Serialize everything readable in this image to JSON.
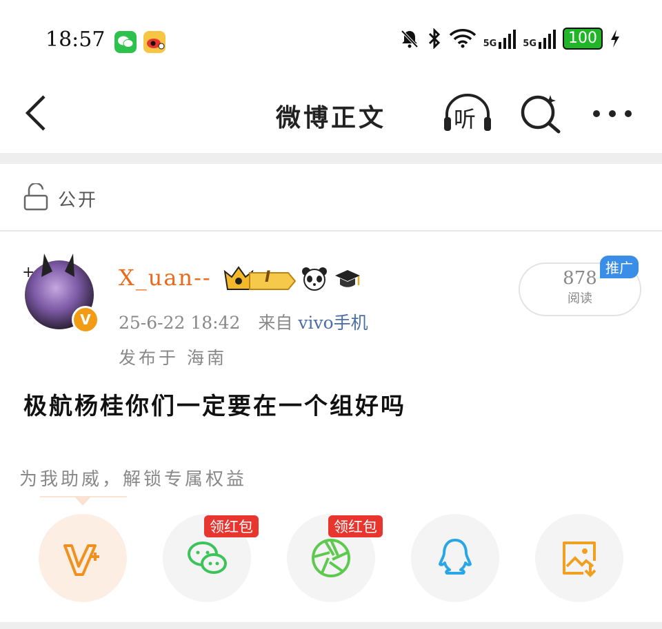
{
  "status_bar": {
    "time": "18:57",
    "network_1": "5G",
    "network_2": "5G",
    "battery": "100"
  },
  "header": {
    "title": "微博正文",
    "listen_label": "听"
  },
  "visibility": {
    "label": "公开"
  },
  "post": {
    "username": "X_uan--",
    "vip_level": "I",
    "datetime": "25-6-22 18:42",
    "from_prefix": "来自",
    "source": "vivo手机",
    "location": "发布于 海南",
    "content": "极航杨桂你们一定要在一个组好吗",
    "reads_count": "878",
    "reads_label": "阅读",
    "promo_label": "推广"
  },
  "share": {
    "tip": "为我助威，解锁专属权益",
    "wechat_tag": "领红包",
    "moments_tag": "领红包"
  },
  "colors": {
    "accent_orange": "#e86a1a",
    "source_blue": "#4b6ea8",
    "red_tag": "#e8362e",
    "battery_green": "#22b52a"
  }
}
